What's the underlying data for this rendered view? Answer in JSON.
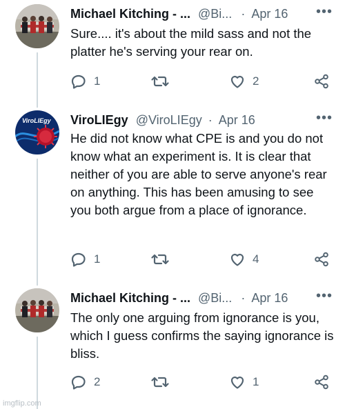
{
  "tweets": [
    {
      "name": "Michael Kitching - ...",
      "handle": "@Bi...",
      "dot": "·",
      "date": "Apr 16",
      "more": "•••",
      "body": "Sure.... it's about the mild sass and not the platter he's serving your rear on.",
      "replies": "1",
      "retweets": "",
      "likes": "2"
    },
    {
      "name": "ViroLIEgy",
      "handle": "@ViroLIEgy",
      "dot": "·",
      "date": "Apr 16",
      "more": "•••",
      "avatar_text": "ViroLIEgy",
      "body": "He did not know what CPE is and you do not know what an experiment is. It is clear that neither of you are able to serve anyone's rear on anything. This has been amusing to see you both argue from a place of ignorance.",
      "replies": "1",
      "retweets": "",
      "likes": "4"
    },
    {
      "name": "Michael Kitching - ...",
      "handle": "@Bi...",
      "dot": "·",
      "date": "Apr 16",
      "more": "•••",
      "body": "The only one arguing from ignorance is you, which I guess confirms the saying ignorance is bliss.",
      "replies": "2",
      "retweets": "",
      "likes": "1"
    }
  ],
  "watermark": "imgflip.com",
  "colors": {
    "text": "#0f1419",
    "secondary": "#536471",
    "thread_line": "#cfd9de"
  }
}
